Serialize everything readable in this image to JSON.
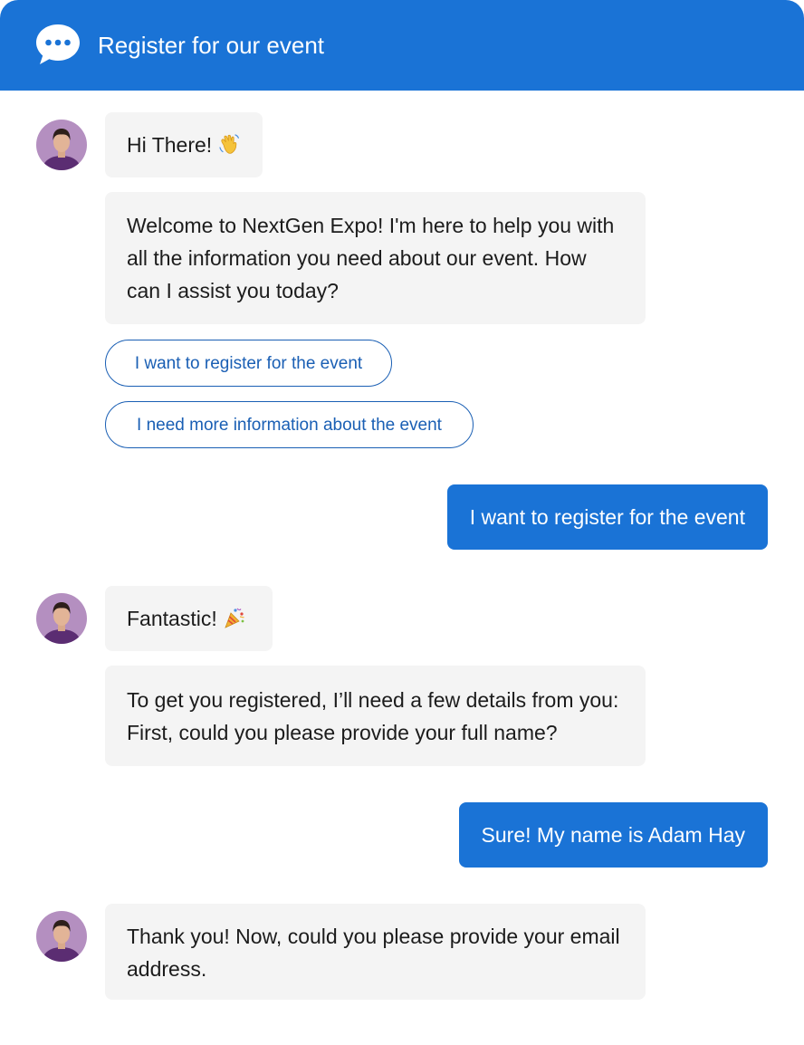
{
  "header": {
    "title": "Register for our event",
    "icon": "chat-bubble-icon"
  },
  "colors": {
    "primary": "#1a73d6",
    "bot_bubble": "#f4f4f4",
    "option_text": "#1a5fb4"
  },
  "messages": {
    "m1": {
      "text": "Hi There!",
      "emoji": "waving-hand-icon"
    },
    "m2": {
      "text": "Welcome to NextGen Expo! I'm here to help you with all the information you need about our event. How can I assist you today?"
    },
    "options": [
      {
        "label": "I want to register for the event"
      },
      {
        "label": "I need more information about the event"
      }
    ],
    "u1": {
      "text": "I want to register for the event"
    },
    "m3": {
      "text": "Fantastic!",
      "emoji": "party-popper-icon"
    },
    "m4": {
      "text": "To get you registered, I’ll need a few details from you: First, could you please provide your full name?"
    },
    "u2": {
      "text": "Sure! My name is Adam Hay"
    },
    "m5": {
      "text": "Thank you! Now, could you please provide your email address."
    }
  }
}
